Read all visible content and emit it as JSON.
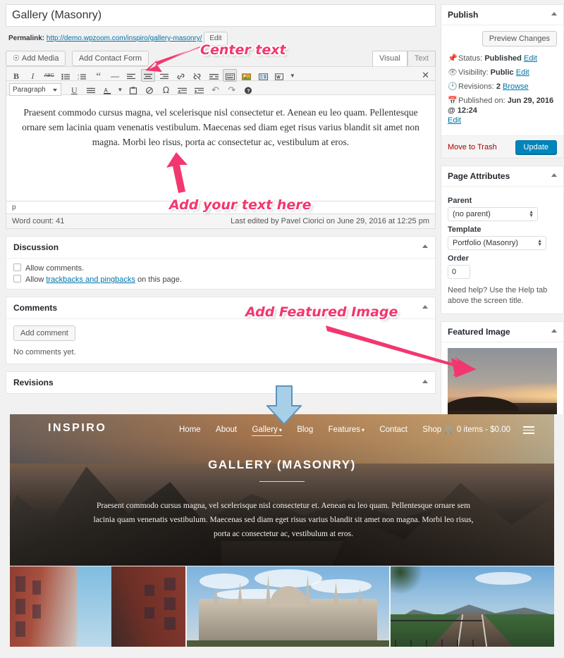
{
  "editor": {
    "title": "Gallery (Masonry)",
    "permalink_label": "Permalink:",
    "permalink_url": "http://demo.wpzoom.com/inspiro/gallery-masonry/",
    "permalink_edit": "Edit",
    "add_media": "Add Media",
    "add_contact_form": "Add Contact Form",
    "tab_visual": "Visual",
    "tab_text": "Text",
    "format_select": "Paragraph",
    "content_paragraph": "Praesent commodo cursus magna, vel scelerisque nisl consectetur et. Aenean eu leo quam. Pellentesque ornare sem lacinia quam venenatis vestibulum. Maecenas sed diam eget risus varius blandit sit amet non magna. Morbi leo risus, porta ac consectetur ac, vestibulum at eros.",
    "path": "p",
    "word_count": "Word count: 41",
    "last_edited": "Last edited by Pavel Ciorici on June 29, 2016 at 12:25 pm",
    "toolbar_row1": [
      {
        "name": "bold-icon",
        "glyph": "B"
      },
      {
        "name": "italic-icon",
        "glyph": "I"
      },
      {
        "name": "strikethrough-icon",
        "glyph": "ABC"
      },
      {
        "name": "bulleted-list-icon",
        "glyph": "≡"
      },
      {
        "name": "numbered-list-icon",
        "glyph": "≡"
      },
      {
        "name": "blockquote-icon",
        "glyph": "“"
      },
      {
        "name": "horizontal-rule-icon",
        "glyph": "—"
      },
      {
        "name": "align-left-icon",
        "glyph": "≡"
      },
      {
        "name": "align-center-icon",
        "glyph": "≡"
      },
      {
        "name": "align-right-icon",
        "glyph": "≡"
      },
      {
        "name": "insert-link-icon",
        "glyph": "🔗"
      },
      {
        "name": "remove-link-icon",
        "glyph": "⛓"
      },
      {
        "name": "read-more-icon",
        "glyph": "☰"
      },
      {
        "name": "toggle-toolbar-icon",
        "glyph": "⌨"
      },
      {
        "name": "slider-icon",
        "glyph": "🖼"
      },
      {
        "name": "portfolio-icon",
        "glyph": "▦"
      },
      {
        "name": "wpzoom-shortcode-icon",
        "glyph": "W"
      }
    ],
    "toolbar_row2": [
      {
        "name": "underline-icon",
        "glyph": "U"
      },
      {
        "name": "justify-icon",
        "glyph": "≡"
      },
      {
        "name": "text-color-icon",
        "glyph": "A"
      },
      {
        "name": "paste-as-text-icon",
        "glyph": "📋"
      },
      {
        "name": "clear-formatting-icon",
        "glyph": "⊘"
      },
      {
        "name": "special-character-icon",
        "glyph": "Ω"
      },
      {
        "name": "decrease-indent-icon",
        "glyph": "⇤"
      },
      {
        "name": "increase-indent-icon",
        "glyph": "⇥"
      },
      {
        "name": "undo-icon",
        "glyph": "↶"
      },
      {
        "name": "redo-icon",
        "glyph": "↷"
      },
      {
        "name": "keyboard-shortcuts-icon",
        "glyph": "?"
      }
    ],
    "fullscreen_icon": "✕"
  },
  "discussion": {
    "title": "Discussion",
    "allow_comments": "Allow comments.",
    "allow_trackbacks_pre": "Allow ",
    "allow_trackbacks_link": "trackbacks and pingbacks",
    "allow_trackbacks_post": " on this page."
  },
  "comments": {
    "title": "Comments",
    "add_comment": "Add comment",
    "empty": "No comments yet."
  },
  "revisions": {
    "title": "Revisions"
  },
  "publish": {
    "title": "Publish",
    "preview_changes": "Preview Changes",
    "status_label": "Status:",
    "status_value": "Published",
    "status_edit": "Edit",
    "visibility_label": "Visibility:",
    "visibility_value": "Public",
    "visibility_edit": "Edit",
    "revisions_label": "Revisions:",
    "revisions_value": "2",
    "revisions_browse": "Browse",
    "published_label": "Published on:",
    "published_value": "Jun 29, 2016 @ 12:24",
    "published_edit": "Edit",
    "move_to_trash": "Move to Trash",
    "update": "Update",
    "accent_color": "#0085ba",
    "trash_color": "#a00"
  },
  "page_attributes": {
    "title": "Page Attributes",
    "parent_label": "Parent",
    "parent_value": "(no parent)",
    "template_label": "Template",
    "template_value": "Portfolio (Masonry)",
    "order_label": "Order",
    "order_value": "0",
    "help_text": "Need help? Use the Help tab above the screen title."
  },
  "featured_image": {
    "title": "Featured Image"
  },
  "annotations": {
    "accent_color": "#f2376f",
    "blue_arrow_color": "#8ec3e6",
    "center_text": "Center text",
    "add_your_text": "Add your text here",
    "add_featured_image": "Add Featured Image"
  },
  "preview": {
    "brand": "INSPIRO",
    "menu": [
      {
        "label": "Home",
        "caret": false,
        "current": false
      },
      {
        "label": "About",
        "caret": false,
        "current": false
      },
      {
        "label": "Gallery",
        "caret": true,
        "current": true
      },
      {
        "label": "Blog",
        "caret": false,
        "current": false
      },
      {
        "label": "Features",
        "caret": true,
        "current": false
      },
      {
        "label": "Contact",
        "caret": false,
        "current": false
      },
      {
        "label": "Shop",
        "caret": false,
        "current": false
      }
    ],
    "cart": "0 items - $0.00",
    "hero_title": "GALLERY (MASONRY)",
    "hero_text": "Praesent commodo cursus magna, vel scelerisque nisl consectetur et. Aenean eu leo quam. Pellentesque ornare sem lacinia quam venenatis vestibulum. Maecenas sed diam eget risus varius blandit sit amet non magna. Morbi leo risus, porta ac consectetur ac, vestibulum at eros.",
    "gallery": [
      {
        "name": "gallery-image-urban-buildings"
      },
      {
        "name": "gallery-image-gothic-cathedral"
      },
      {
        "name": "gallery-image-railway-mountains"
      }
    ]
  }
}
